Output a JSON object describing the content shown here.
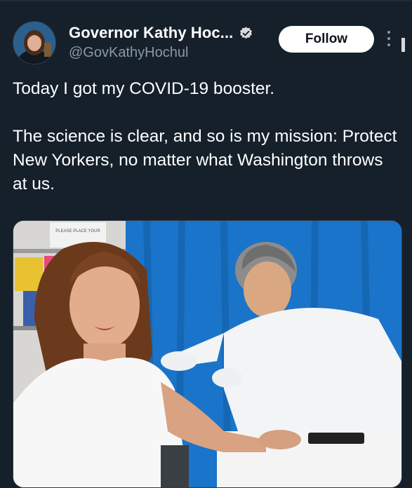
{
  "tweet": {
    "author": {
      "display_name": "Governor Kathy Hoc...",
      "handle": "@GovKathyHochul",
      "verified": true,
      "avatar_icon": "profile-photo"
    },
    "follow_label": "Follow",
    "more_icon": "more-vertical-icon",
    "text": "Today I got my COVID-19 booster.\n\nThe science is clear, and so is my mission: Protect New Yorkers, no matter what Washington throws at us.",
    "media": {
      "type": "photo",
      "sign_text": "PLEASE PLACE YOUR"
    }
  },
  "colors": {
    "background": "#15202b",
    "text_primary": "#ffffff",
    "text_secondary": "#8899a6",
    "verified_badge": "#d9d9d9",
    "curtain_blue": "#1a74c9"
  }
}
